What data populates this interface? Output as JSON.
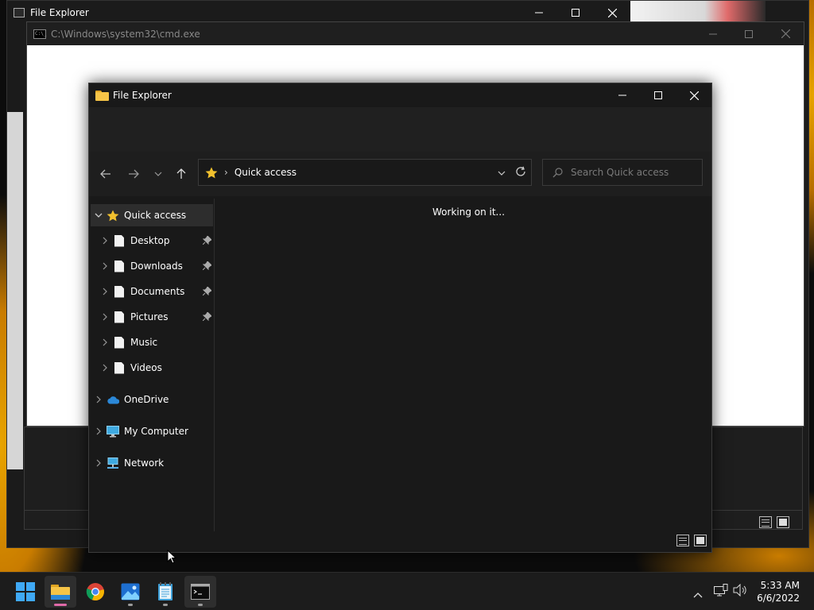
{
  "back_window": {
    "title": "File Explorer"
  },
  "cmd_window": {
    "title": "C:\\Windows\\system32\\cmd.exe",
    "icon_label": "C:\\_"
  },
  "explorer": {
    "title": "File Explorer",
    "address": {
      "location": "Quick access"
    },
    "search": {
      "placeholder": "Search Quick access"
    },
    "nav_tree": [
      {
        "label": "Quick access",
        "icon": "star-icon",
        "pinned": false,
        "selected": true,
        "expanded": true
      },
      {
        "label": "Desktop",
        "icon": "document-icon",
        "pinned": true
      },
      {
        "label": "Downloads",
        "icon": "document-icon",
        "pinned": true
      },
      {
        "label": "Documents",
        "icon": "document-icon",
        "pinned": true
      },
      {
        "label": "Pictures",
        "icon": "document-icon",
        "pinned": true
      },
      {
        "label": "Music",
        "icon": "document-icon",
        "pinned": false
      },
      {
        "label": "Videos",
        "icon": "document-icon",
        "pinned": false
      },
      {
        "label": "OneDrive",
        "icon": "cloud-icon",
        "pinned": false
      },
      {
        "label": "My Computer",
        "icon": "monitor-icon",
        "pinned": false
      },
      {
        "label": "Network",
        "icon": "network-icon",
        "pinned": false
      }
    ],
    "content_message": "Working on it..."
  },
  "taskbar": {
    "apps": [
      {
        "name": "start",
        "icon": "windows-logo-icon"
      },
      {
        "name": "file-explorer",
        "icon": "folder-icon",
        "active": true
      },
      {
        "name": "chrome",
        "icon": "chrome-icon"
      },
      {
        "name": "photos",
        "icon": "photos-icon"
      },
      {
        "name": "notepad",
        "icon": "notepad-icon"
      },
      {
        "name": "command-prompt",
        "icon": "terminal-icon",
        "active": true
      }
    ],
    "clock": {
      "time": "5:33 AM",
      "date": "6/6/2022"
    }
  },
  "colors": {
    "accent_folder": "#f6c447",
    "star": "#f2c12e",
    "onedrive": "#2b88d8",
    "taskbar": "#1c1c1c",
    "window_bg": "#191919"
  }
}
